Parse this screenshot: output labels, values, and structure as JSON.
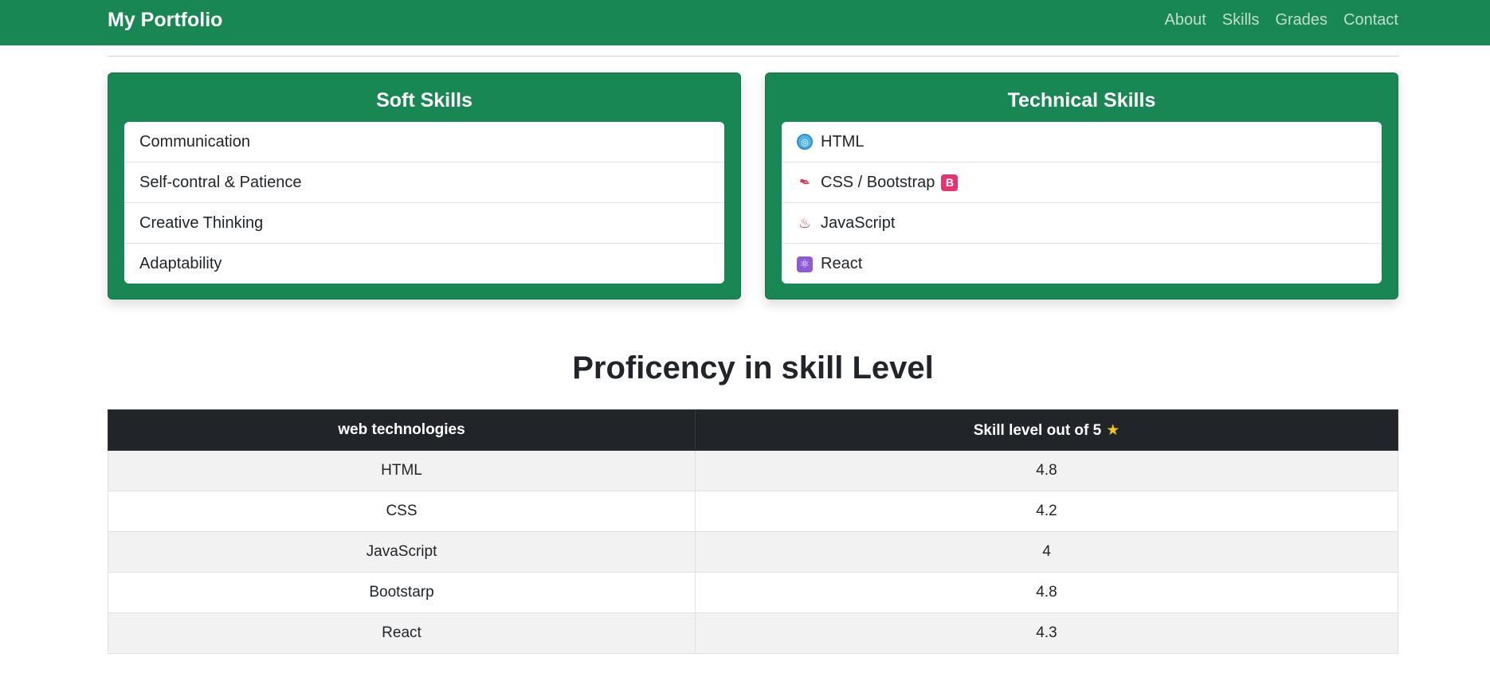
{
  "nav": {
    "brand": "My Portfolio",
    "links": [
      "About",
      "Skills",
      "Grades",
      "Contact"
    ]
  },
  "soft_skills": {
    "title": "Soft Skills",
    "items": [
      "Communication",
      "Self-contral & Patience",
      "Creative Thinking",
      "Adaptability"
    ]
  },
  "technical_skills": {
    "title": "Technical Skills",
    "items": [
      {
        "label": "HTML",
        "icon": "globe-icon"
      },
      {
        "label": "CSS / Bootstrap",
        "icon": "paintbrush-icon",
        "badge": "B"
      },
      {
        "label": "JavaScript",
        "icon": "hot-springs-icon"
      },
      {
        "label": "React",
        "icon": "atom-icon"
      }
    ]
  },
  "proficiency": {
    "title": "Proficency in skill Level",
    "headers": [
      "web technologies",
      "Skill level out of 5"
    ],
    "header_icon": "star-icon",
    "rows": [
      [
        "HTML",
        "4.8"
      ],
      [
        "CSS",
        "4.2"
      ],
      [
        "JavaScript",
        "4"
      ],
      [
        "Bootstarp",
        "4.8"
      ],
      [
        "React",
        "4.3"
      ]
    ]
  },
  "colors": {
    "brand_green": "#198754",
    "table_header": "#212529"
  }
}
